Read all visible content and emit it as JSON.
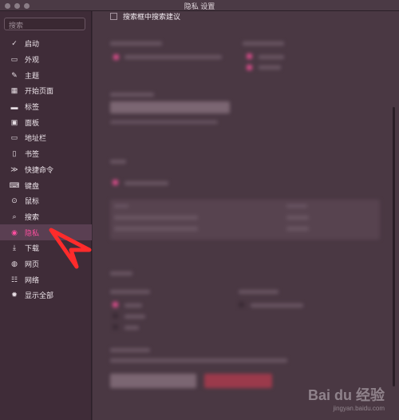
{
  "window": {
    "title": "隐私 设置"
  },
  "sidebar": {
    "search_placeholder": "搜索",
    "items": [
      {
        "label": "启动",
        "icon": "✓"
      },
      {
        "label": "外观",
        "icon": "▭"
      },
      {
        "label": "主题",
        "icon": "✎"
      },
      {
        "label": "开始页面",
        "icon": "▦"
      },
      {
        "label": "标签",
        "icon": "▬"
      },
      {
        "label": "面板",
        "icon": "▣"
      },
      {
        "label": "地址栏",
        "icon": "▭"
      },
      {
        "label": "书签",
        "icon": "▯"
      },
      {
        "label": "快捷命令",
        "icon": "≫"
      },
      {
        "label": "键盘",
        "icon": "⌨"
      },
      {
        "label": "鼠标",
        "icon": "⊙"
      },
      {
        "label": "搜索",
        "icon": "⌕"
      },
      {
        "label": "隐私",
        "icon": "◉",
        "active": true
      },
      {
        "label": "下载",
        "icon": "⤓"
      },
      {
        "label": "网页",
        "icon": "◍"
      },
      {
        "label": "网络",
        "icon": "☷"
      },
      {
        "label": "显示全部",
        "icon": "✹"
      }
    ]
  },
  "main": {
    "top_checkbox_label": "搜索框中搜索建议",
    "watermark_brand": "Bai du 经验",
    "watermark_url": "jingyan.baidu.com",
    "accent_color": "#ff4fa0"
  }
}
